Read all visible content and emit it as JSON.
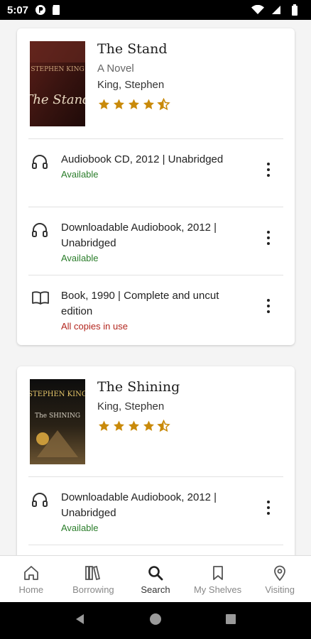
{
  "status_bar": {
    "time": "5:07",
    "icons": [
      "p-icon",
      "sd-card-icon",
      "wifi-icon",
      "signal-icon",
      "battery-icon"
    ]
  },
  "books": [
    {
      "title": "The Stand",
      "subtitle": "A Novel",
      "author": "King, Stephen",
      "rating_stars": 4.5,
      "cover": {
        "author_text": "STEPHEN KING",
        "title_text": "The Stand"
      },
      "formats": [
        {
          "icon": "headphones-icon",
          "title": "Audiobook CD, 2012 | Unabridged",
          "status": "Available",
          "status_kind": "ok"
        },
        {
          "icon": "headphones-icon",
          "title": "Downloadable Audiobook, 2012 | Unabridged",
          "status": "Available",
          "status_kind": "ok"
        },
        {
          "icon": "book-icon",
          "title": "Book, 1990 | Complete and uncut edition",
          "status": "All copies in use",
          "status_kind": "busy"
        }
      ]
    },
    {
      "title": "The Shining",
      "author": "King, Stephen",
      "rating_stars": 4.5,
      "cover": {
        "author_text": "STEPHEN KING",
        "title_text": "The SHINING"
      },
      "formats": [
        {
          "icon": "headphones-icon",
          "title": "Downloadable Audiobook, 2012 | Unabridged",
          "status": "Available",
          "status_kind": "ok"
        }
      ]
    }
  ],
  "tabs": [
    {
      "label": "Home",
      "icon": "home-icon"
    },
    {
      "label": "Borrowing",
      "icon": "books-icon"
    },
    {
      "label": "Search",
      "icon": "search-icon",
      "active": true
    },
    {
      "label": "My Shelves",
      "icon": "bookmark-icon"
    },
    {
      "label": "Visiting",
      "icon": "location-pin-icon"
    }
  ],
  "colors": {
    "star": "#c98a0a",
    "available": "#2a7d2a",
    "in_use": "#b3261e"
  }
}
